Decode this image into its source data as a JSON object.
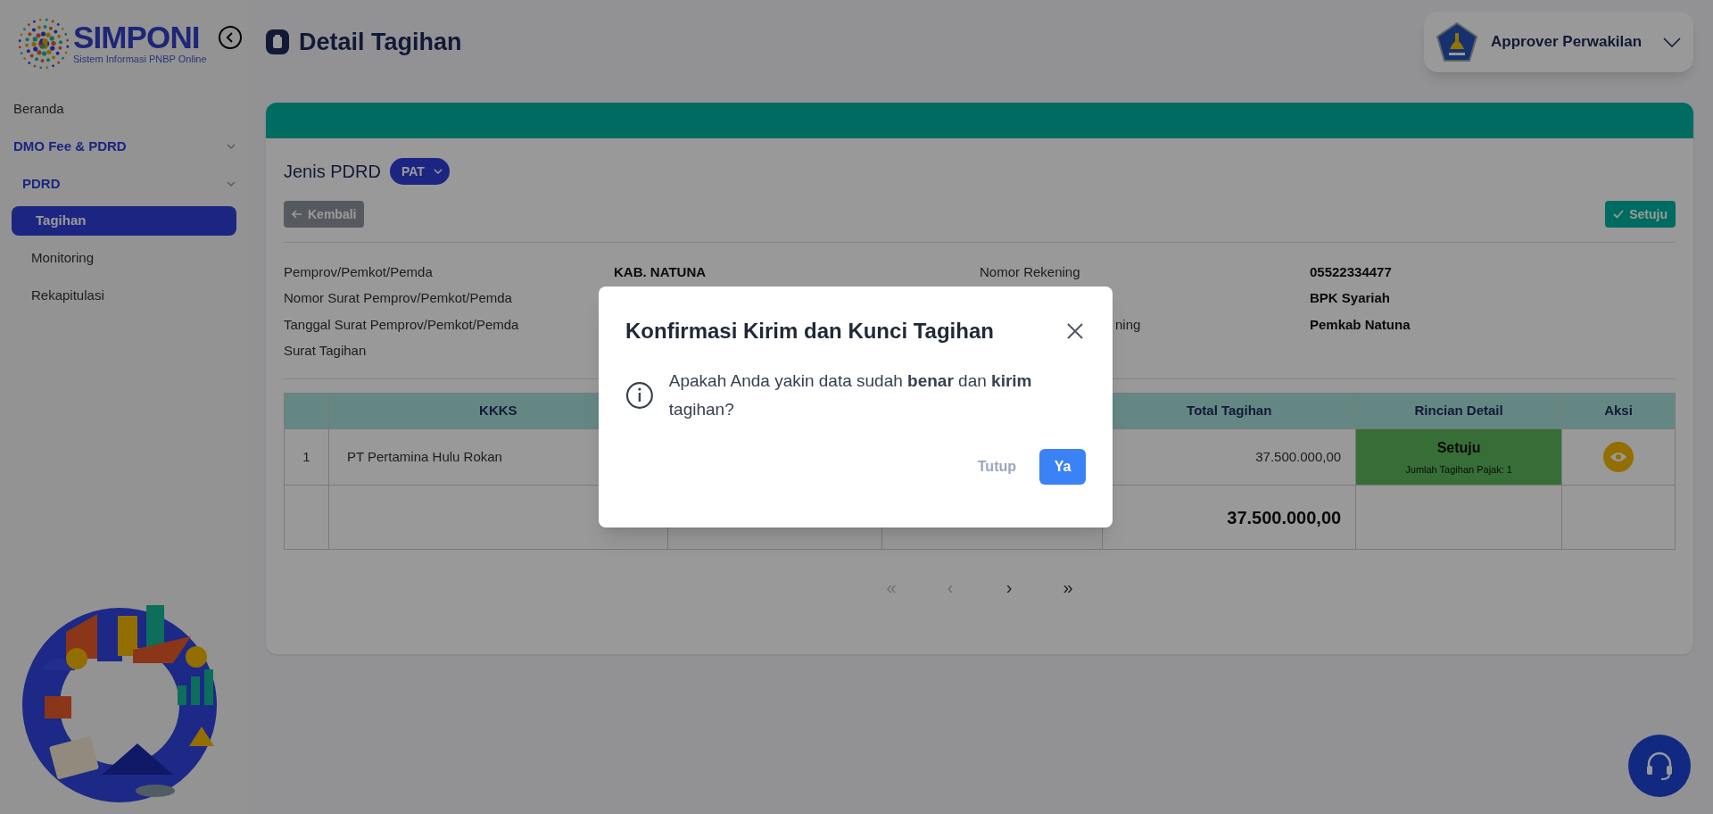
{
  "sidebar": {
    "logo": {
      "name": "SIMPONI",
      "tagline": "Sistem Informasi PNBP Online"
    },
    "items": [
      {
        "label": "Beranda",
        "kind": "link",
        "selected": false
      },
      {
        "label": "DMO Fee & PDRD",
        "kind": "group",
        "expanded": true,
        "children": [
          {
            "label": "PDRD",
            "kind": "group",
            "expanded": true,
            "children": [
              {
                "label": "Tagihan",
                "kind": "link",
                "selected": true
              },
              {
                "label": "Monitoring",
                "kind": "link",
                "selected": false
              },
              {
                "label": "Rekapitulasi",
                "kind": "link",
                "selected": false
              }
            ]
          }
        ]
      }
    ]
  },
  "header": {
    "title": "Detail Tagihan",
    "user": {
      "role": "Approver Perwakilan"
    }
  },
  "card": {
    "jenis_label": "Jenis PDRD",
    "jenis_value": "PAT",
    "back_button": "Kembali",
    "approve_button": "Setuju",
    "info_left": [
      {
        "label": "Pemprov/Pemkot/Pemda",
        "value": "KAB. NATUNA"
      },
      {
        "label": "Nomor Surat Pemprov/Pemkot/Pemda"
      },
      {
        "label": "Tanggal Surat Pemprov/Pemkot/Pemda"
      },
      {
        "label": "Surat Tagihan"
      }
    ],
    "info_right": [
      {
        "label": "Nomor Rekening",
        "value": "05522334477"
      },
      {
        "value": "BPK Syariah"
      },
      {
        "label": "ning",
        "partial": true,
        "value": "Pemkab Natuna"
      }
    ],
    "table": {
      "columns": [
        "KKKS",
        "Total Tagihan",
        "Rincian Detail",
        "Aksi"
      ],
      "rows": [
        {
          "number": "1",
          "kkks": "PT Pertamina Hulu Rokan",
          "total": "37.500.000,00",
          "detail": {
            "status": "Setuju",
            "note": "Jumlah Tagihan Pajak: 1"
          },
          "action": {
            "kind": "view"
          }
        }
      ],
      "total_row": {
        "total": "37.500.000,00"
      }
    },
    "pagination": [
      {
        "label": "«",
        "disabled": true
      },
      {
        "label": "‹",
        "disabled": true
      },
      {
        "label": "›",
        "disabled": false
      },
      {
        "label": "»",
        "disabled": false
      }
    ]
  },
  "dialog": {
    "title": "Konfirmasi Kirim dan Kunci Tagihan",
    "message": "Apakah Anda yakin data sudah **benar** dan **kirim** tagihan?",
    "buttons": [
      {
        "label": "Tutup",
        "kind": "secondary"
      },
      {
        "label": "Ya",
        "kind": "primary"
      }
    ]
  }
}
